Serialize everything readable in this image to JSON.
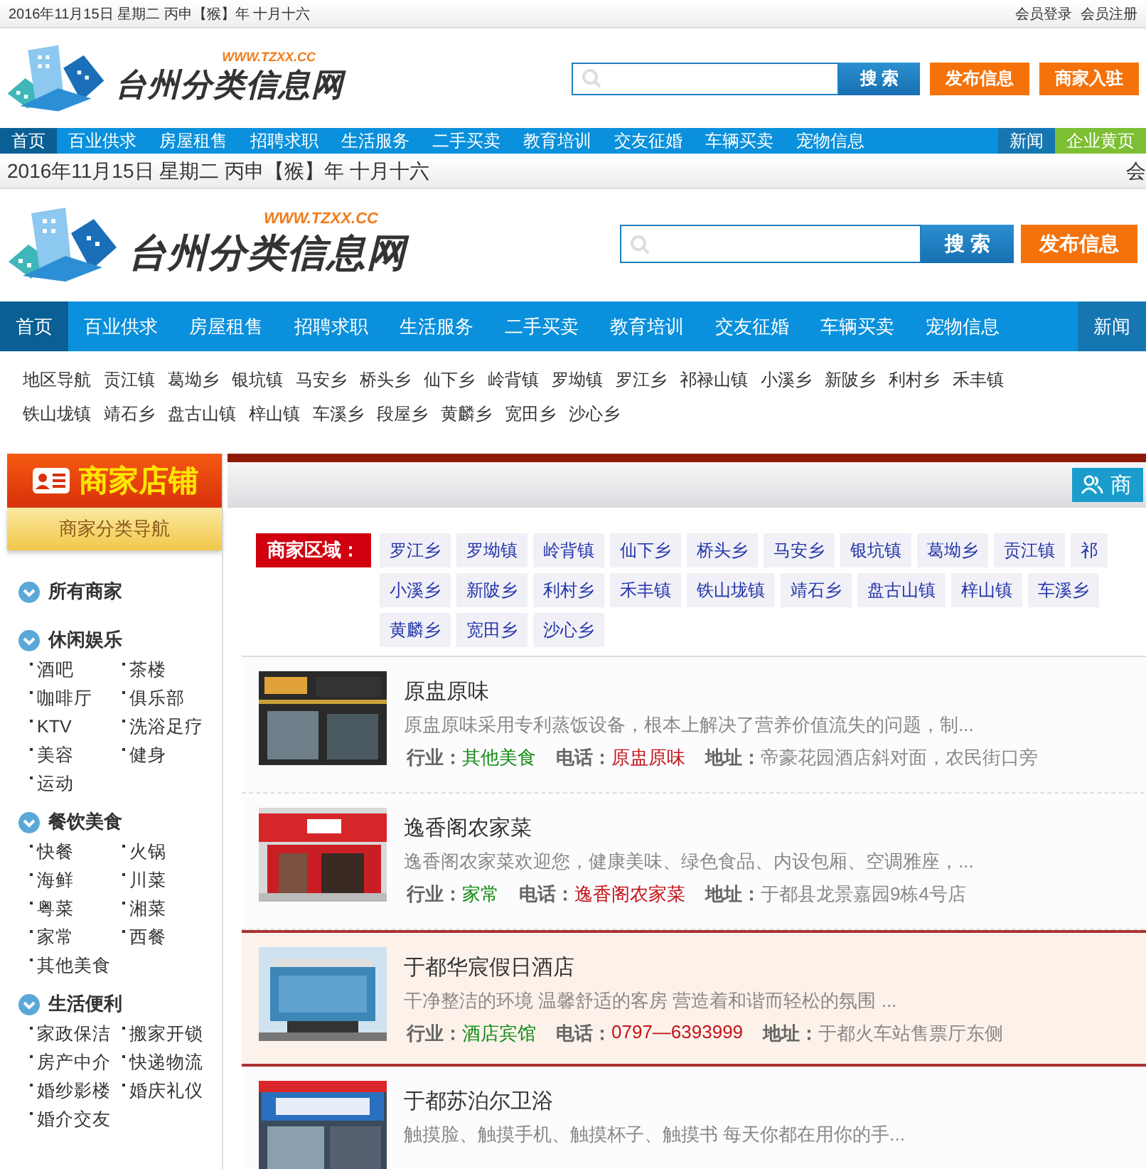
{
  "overlay_header": {
    "date": "2016年11月15日 星期二  丙申【猴】年 十月十六",
    "links": [
      "会员登录",
      "会员注册"
    ],
    "logo": {
      "name": "台州分类信息网",
      "url": "WWW.TZXX.CC"
    },
    "search_button": "搜 索",
    "buttons": [
      "发布信息",
      "商家入驻"
    ],
    "nav": [
      {
        "label": "首页",
        "selected": true,
        "kind": "plain"
      },
      {
        "label": "百业供求",
        "selected": false,
        "kind": "plain"
      },
      {
        "label": "房屋租售",
        "selected": false,
        "kind": "plain"
      },
      {
        "label": "招聘求职",
        "selected": false,
        "kind": "plain"
      },
      {
        "label": "生活服务",
        "selected": false,
        "kind": "plain"
      },
      {
        "label": "二手买卖",
        "selected": false,
        "kind": "plain"
      },
      {
        "label": "教育培训",
        "selected": false,
        "kind": "plain"
      },
      {
        "label": "交友征婚",
        "selected": false,
        "kind": "plain"
      },
      {
        "label": "车辆买卖",
        "selected": false,
        "kind": "plain"
      },
      {
        "label": "宠物信息",
        "selected": false,
        "kind": "plain"
      },
      {
        "label": "新闻",
        "selected": false,
        "kind": "dark"
      },
      {
        "label": "企业黄页",
        "selected": false,
        "kind": "green"
      }
    ]
  },
  "header": {
    "date": "2016年11月15日 星期二  丙申【猴】年 十月十六",
    "links": [
      "会"
    ],
    "logo": {
      "name": "台州分类信息网",
      "url": "WWW.TZXX.CC"
    },
    "search_button": "搜 索",
    "buttons": [
      "发布信息"
    ],
    "nav": [
      {
        "label": "首页",
        "selected": true,
        "kind": "plain"
      },
      {
        "label": "百业供求",
        "selected": false,
        "kind": "plain"
      },
      {
        "label": "房屋租售",
        "selected": false,
        "kind": "plain"
      },
      {
        "label": "招聘求职",
        "selected": false,
        "kind": "plain"
      },
      {
        "label": "生活服务",
        "selected": false,
        "kind": "plain"
      },
      {
        "label": "二手买卖",
        "selected": false,
        "kind": "plain"
      },
      {
        "label": "教育培训",
        "selected": false,
        "kind": "plain"
      },
      {
        "label": "交友征婚",
        "selected": false,
        "kind": "plain"
      },
      {
        "label": "车辆买卖",
        "selected": false,
        "kind": "plain"
      },
      {
        "label": "宠物信息",
        "selected": false,
        "kind": "plain"
      },
      {
        "label": "新闻",
        "selected": false,
        "kind": "dark"
      }
    ],
    "regions": [
      "地区导航",
      "贡江镇",
      "葛坳乡",
      "银坑镇",
      "马安乡",
      "桥头乡",
      "仙下乡",
      "岭背镇",
      "罗坳镇",
      "罗江乡",
      "祁禄山镇",
      "小溪乡",
      "新陂乡",
      "利村乡",
      "禾丰镇",
      "铁山垅镇",
      "靖石乡",
      "盘古山镇",
      "梓山镇",
      "车溪乡",
      "段屋乡",
      "黄麟乡",
      "宽田乡",
      "沙心乡"
    ]
  },
  "sidebar": {
    "title": "商家店铺",
    "subtitle": "商家分类导航",
    "groups": [
      {
        "title": "所有商家"
      },
      {
        "title": "休闲娱乐",
        "items": [
          "酒吧",
          "茶楼",
          "咖啡厅",
          "俱乐部",
          "KTV",
          "洗浴足疗",
          "美容",
          "健身",
          "运动"
        ]
      },
      {
        "title": "餐饮美食",
        "items": [
          "快餐",
          "火锅",
          "海鲜",
          "川菜",
          "粤菜",
          "湘菜",
          "家常",
          "西餐",
          "其他美食"
        ]
      },
      {
        "title": "生活便利",
        "items": [
          "家政保洁",
          "搬家开锁",
          "房产中介",
          "快递物流",
          "婚纱影楼",
          "婚庆礼仪",
          "婚介交友"
        ]
      }
    ]
  },
  "main": {
    "tab": "商",
    "area_label": "商家区域：",
    "areas": [
      "罗江乡",
      "罗坳镇",
      "岭背镇",
      "仙下乡",
      "桥头乡",
      "马安乡",
      "银坑镇",
      "葛坳乡",
      "贡江镇",
      "祁",
      "小溪乡",
      "新陂乡",
      "利村乡",
      "禾丰镇",
      "铁山垅镇",
      "靖石乡",
      "盘古山镇",
      "梓山镇",
      "车溪乡",
      "黄麟乡",
      "宽田乡",
      "沙心乡"
    ],
    "listings": [
      {
        "title": "原盅原味",
        "description": "原盅原味采用专利蒸饭设备，根本上解决了营养价值流失的问题，制...",
        "highlighted": false,
        "fields": [
          {
            "label": "行业：",
            "value": "其他美食",
            "kind": "industry"
          },
          {
            "label": "电话：",
            "value": "原盅原味",
            "kind": "phone"
          },
          {
            "label": "地址：",
            "value": "帝豪花园酒店斜对面，农民街口旁",
            "kind": "address"
          }
        ]
      },
      {
        "title": "逸香阁农家菜",
        "description": "逸香阁农家菜欢迎您，健康美味、绿色食品、内设包厢、空调雅座，...",
        "highlighted": false,
        "fields": [
          {
            "label": "行业：",
            "value": "家常",
            "kind": "industry"
          },
          {
            "label": "电话：",
            "value": "逸香阁农家菜",
            "kind": "phone"
          },
          {
            "label": "地址：",
            "value": "于都县龙景嘉园9栋4号店",
            "kind": "address"
          }
        ]
      },
      {
        "title": "于都华宸假日酒店",
        "description": "干净整洁的环境 温馨舒适的客房 营造着和谐而轻松的氛围 ...",
        "highlighted": true,
        "fields": [
          {
            "label": "行业：",
            "value": "酒店宾馆",
            "kind": "industry"
          },
          {
            "label": "电话：",
            "value": "0797—6393999",
            "kind": "phone"
          },
          {
            "label": "地址：",
            "value": "于都火车站售票厅东侧",
            "kind": "address"
          }
        ]
      },
      {
        "title": "于都苏泊尔卫浴",
        "description": "触摸脸、触摸手机、触摸杯子、触摸书 每天你都在用你的手...",
        "highlighted": false
      }
    ]
  }
}
